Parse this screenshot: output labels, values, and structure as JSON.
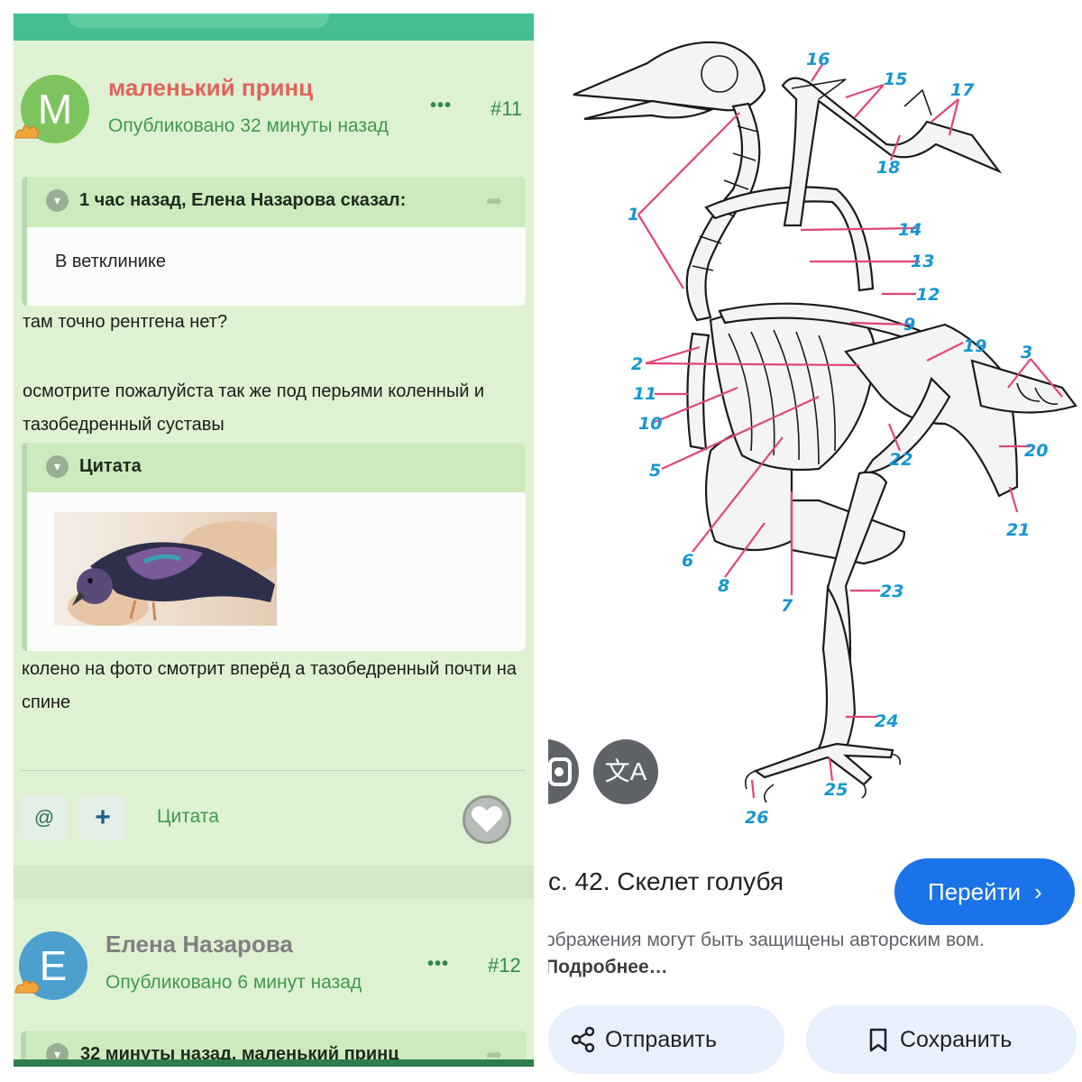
{
  "forum": {
    "post_11": {
      "avatar_letter": "M",
      "author": "маленький принц",
      "posted": "Опубликовано 32 минуты назад",
      "more": "•••",
      "number": "#11",
      "quote": {
        "title": "1 час назад, Елена Назарова сказал:",
        "text": "В ветклинике"
      },
      "text_1": "там точно рентгена нет?",
      "text_2": "осмотрите пожалуйста так же под перьями коленный и тазобедренный суставы",
      "quote_2": {
        "title": "Цитата"
      },
      "text_3": "колено на фото смотрит вперёд а тазобедренный почти на спине",
      "actions": {
        "mention": "@",
        "add": "+",
        "cite": "Цитата"
      }
    },
    "post_12": {
      "avatar_letter": "E",
      "author": "Елена Назарова",
      "posted": "Опубликовано 6 минут назад",
      "more": "•••",
      "number": "#12",
      "quote": {
        "title": "32 минуты назад, маленький принц"
      }
    }
  },
  "viewer": {
    "caption": "с. 42. Скелет голубя",
    "goto_label": "Перейти",
    "notice_text": "ображения могут быть защищены авторским вом.",
    "notice_link": "Подробнее…",
    "send_label": "Отправить",
    "save_label": "Сохранить",
    "translate_glyph": "文A",
    "accent_color": "#1a73e8",
    "skeleton_labels": [
      "1",
      "2",
      "3",
      "5",
      "6",
      "7",
      "8",
      "9",
      "10",
      "11",
      "12",
      "13",
      "14",
      "15",
      "16",
      "17",
      "18",
      "19",
      "20",
      "21",
      "22",
      "23",
      "24",
      "25",
      "26"
    ]
  },
  "icons": [
    "chevron-down-icon",
    "share-arrow-icon",
    "heart-icon",
    "lens-icon",
    "translate-icon",
    "chevron-right-icon",
    "share-icon",
    "bookmark-icon"
  ]
}
